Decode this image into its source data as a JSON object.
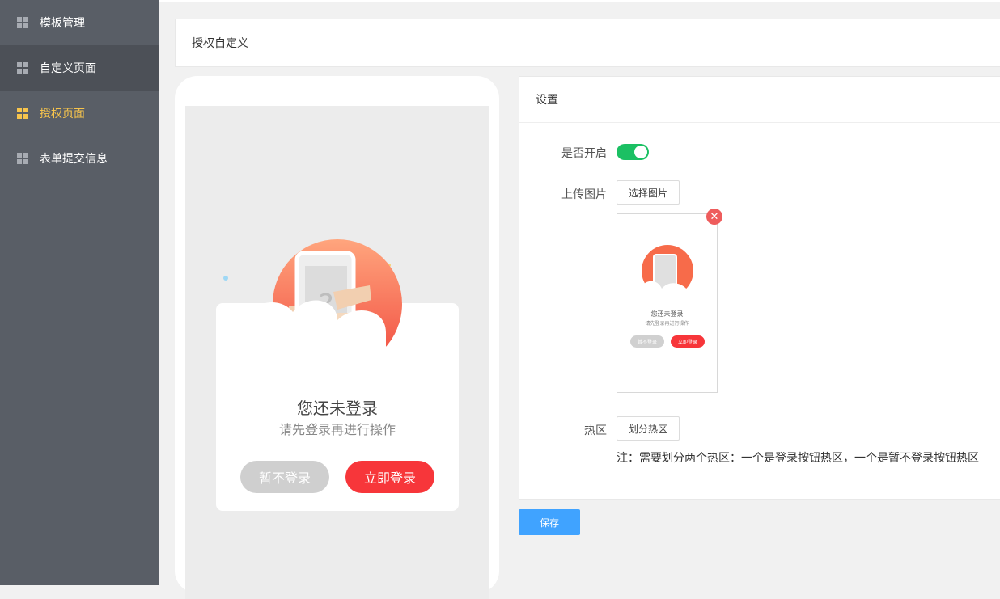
{
  "sidebar": {
    "items": [
      {
        "label": "模板管理"
      },
      {
        "label": "自定义页面"
      },
      {
        "label": "授权页面"
      },
      {
        "label": "表单提交信息"
      }
    ]
  },
  "breadcrumb": {
    "title": "授权自定义"
  },
  "preview": {
    "title": "您还未登录",
    "subtitle": "请先登录再进行操作",
    "later_label": "暂不登录",
    "login_label": "立即登录"
  },
  "thumbnail": {
    "title": "您还未登录",
    "subtitle": "请先登录再进行操作",
    "later_label": "暂不登录",
    "login_label": "立即登录"
  },
  "settings": {
    "title": "设置",
    "enable_label": "是否开启",
    "enabled": true,
    "upload_label": "上传图片",
    "choose_image_label": "选择图片",
    "hotspot_label": "热区",
    "divide_hotspot_label": "划分热区",
    "note": "注：需要划分两个热区：一个是登录按钮热区，一个是暂不登录按钮热区"
  },
  "save_label": "保存",
  "colors": {
    "accent_active": "#f7c44c",
    "toggle_on": "#1bc063",
    "login_red": "#f7363a",
    "save_blue": "#40a3ff"
  }
}
